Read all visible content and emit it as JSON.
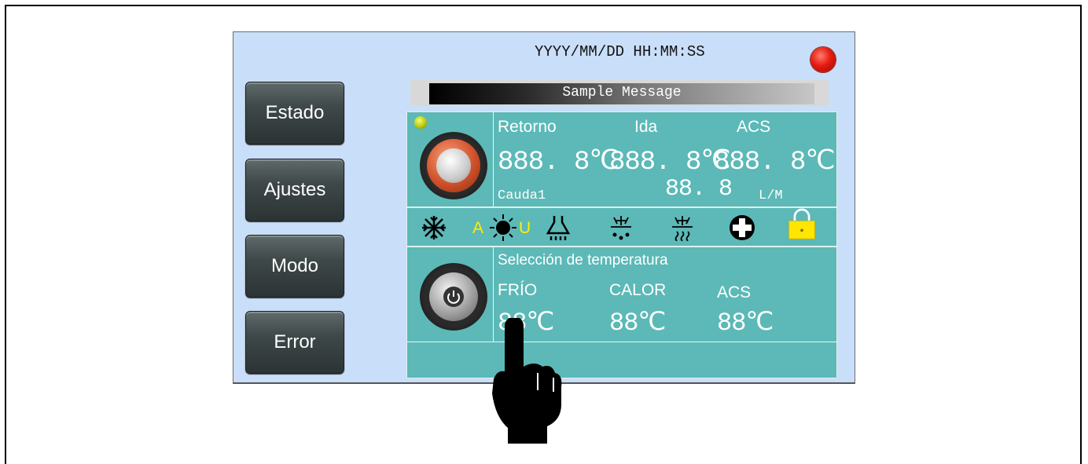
{
  "header": {
    "datetime": "YYYY/MM/DD HH:MM:SS",
    "message": "Sample Message"
  },
  "sidebar": {
    "items": [
      {
        "label": "Estado"
      },
      {
        "label": "Ajustes"
      },
      {
        "label": "Modo"
      },
      {
        "label": "Error"
      }
    ]
  },
  "readings": {
    "labels": {
      "retorno": "Retorno",
      "ida": "Ida",
      "acs": "ACS"
    },
    "retorno_value": "888. 8℃",
    "ida_value": "888. 8℃",
    "acs_value": "888. 8℃",
    "flow_label": "Cauda1",
    "flow_value": "88. 8",
    "flow_unit": "L/M"
  },
  "mode_icons": {
    "auto_left": "A",
    "auto_right": "U",
    "icons": [
      "snowflake-icon",
      "sun-auto-icon",
      "shower-icon",
      "defrost-drip-icon",
      "heat-snow-icon",
      "plus-icon",
      "lock-icon"
    ]
  },
  "temperature_selection": {
    "title": "Selección de temperatura",
    "labels": {
      "frio": "FRÍO",
      "calor": "CALOR",
      "acs": "ACS"
    },
    "frio_value": "88℃",
    "calor_value": "88℃",
    "acs_value": "88℃"
  },
  "colors": {
    "panel": "#5cb9b7",
    "screen_bg": "#c9def8",
    "alarm_led": "#e61b10",
    "status_led": "#c8d400",
    "lock": "#ffe600"
  }
}
